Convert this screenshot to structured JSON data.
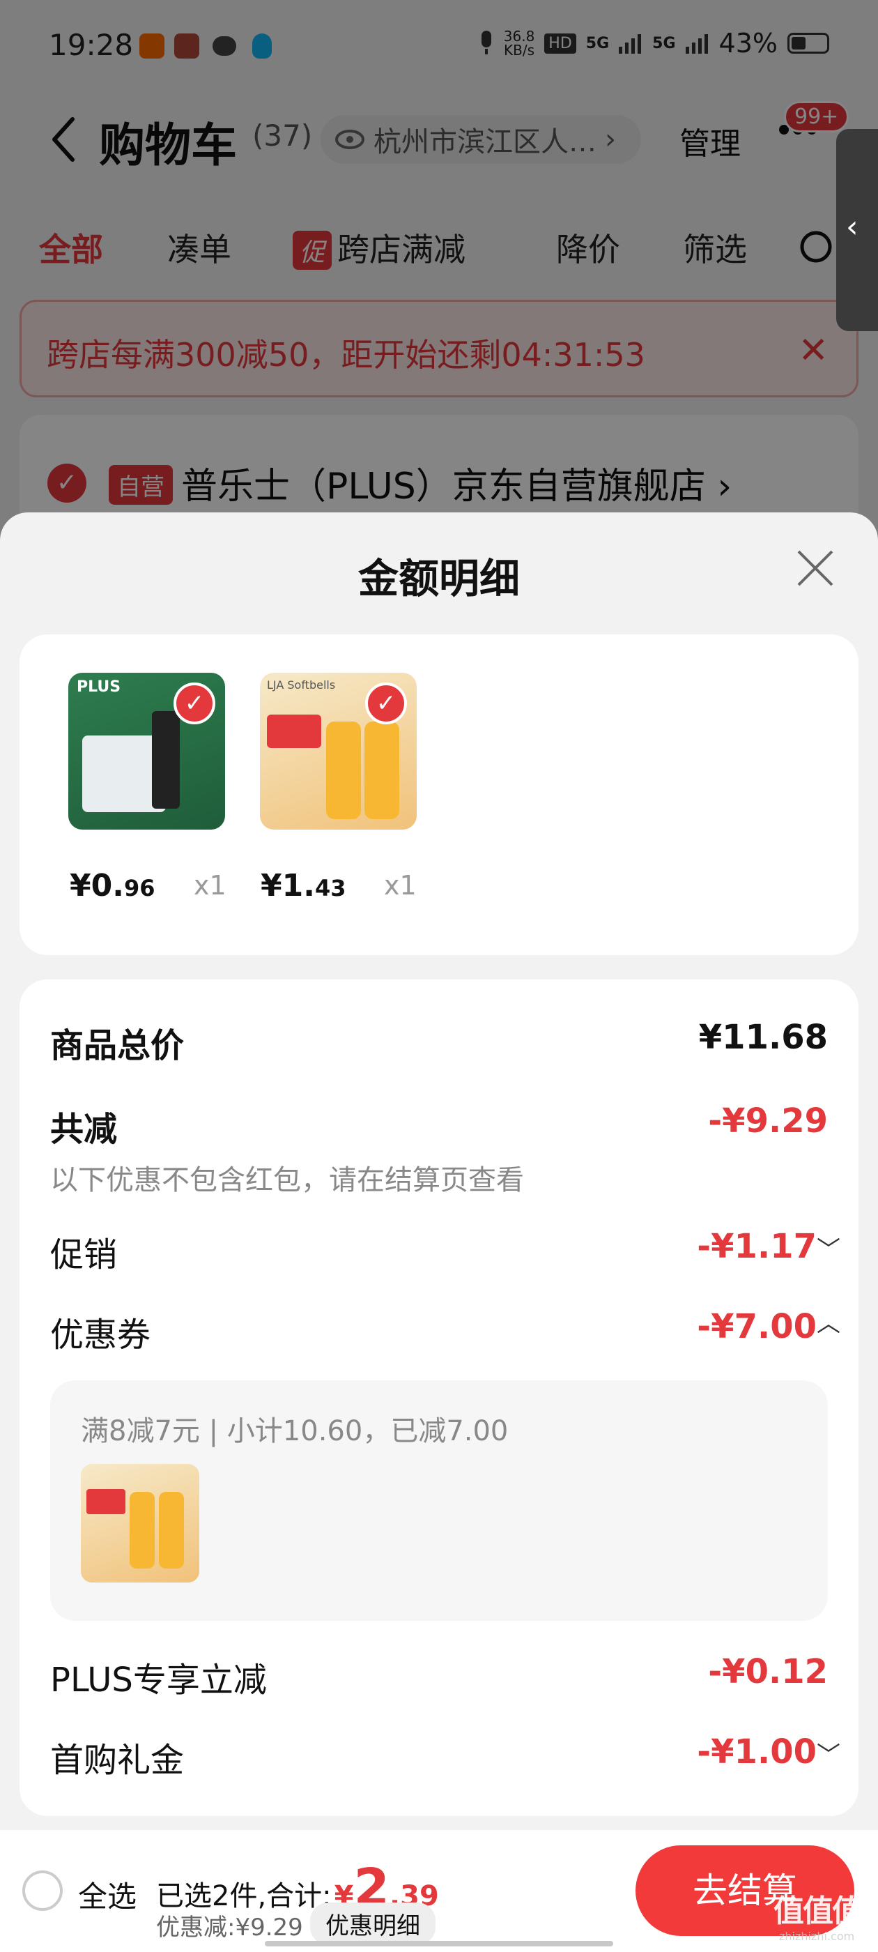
{
  "status_bar": {
    "time": "19:28",
    "net_speed_value": "36.8",
    "net_speed_unit": "KB/s",
    "hd": "HD",
    "net1": "5G",
    "net2": "5G",
    "battery": "43%"
  },
  "nav": {
    "title": "购物车",
    "count": "(37)",
    "location": "杭州市滨江区人…",
    "manage": "管理",
    "badge": "99+"
  },
  "tabs": {
    "all": "全部",
    "bundle": "凑单",
    "promo_tag": "促",
    "cross_store": "跨店满减",
    "price_drop": "降价",
    "filter": "筛选"
  },
  "banner": {
    "text": "跨店每满300减50，距开始还剩04:31:53"
  },
  "store": {
    "self_tag": "自营",
    "name": "普乐士（PLUS）京东自营旗舰店",
    "chevron": "›"
  },
  "sheet": {
    "title": "金额明细",
    "products": [
      {
        "price_int": "¥0.",
        "price_dec": "96",
        "qty": "x1",
        "brand": "PLUS"
      },
      {
        "price_int": "¥1.",
        "price_dec": "43",
        "qty": "x1",
        "brand": "LJA Softbells"
      }
    ],
    "summary": {
      "total_label": "商品总价",
      "total_value": "¥11.68",
      "reduce_label": "共减",
      "reduce_value": "-¥9.29",
      "reduce_note": "以下优惠不包含红包，请在结算页查看",
      "promo_label": "促销",
      "promo_value": "-¥1.17",
      "coupon_label": "优惠券",
      "coupon_value": "-¥7.00",
      "coupon_detail": "满8减7元 | 小计10.60，已减7.00",
      "plus_label": "PLUS专享立减",
      "plus_value": "-¥0.12",
      "gift_label": "首购礼金",
      "gift_value": "-¥1.00"
    }
  },
  "bottom": {
    "select_all": "全选",
    "total_prefix": "已选2件,合计:",
    "yen": "¥",
    "total_int": "2",
    "total_dec": ".39",
    "discount": "优惠减:¥9.29",
    "detail": "优惠明细",
    "checkout": "去结算",
    "watermark": "值值值",
    "watermark_sub": "zhizhizhi.com"
  },
  "colors": {
    "accent": "#e4393c",
    "checkout": "#f23a3a"
  }
}
